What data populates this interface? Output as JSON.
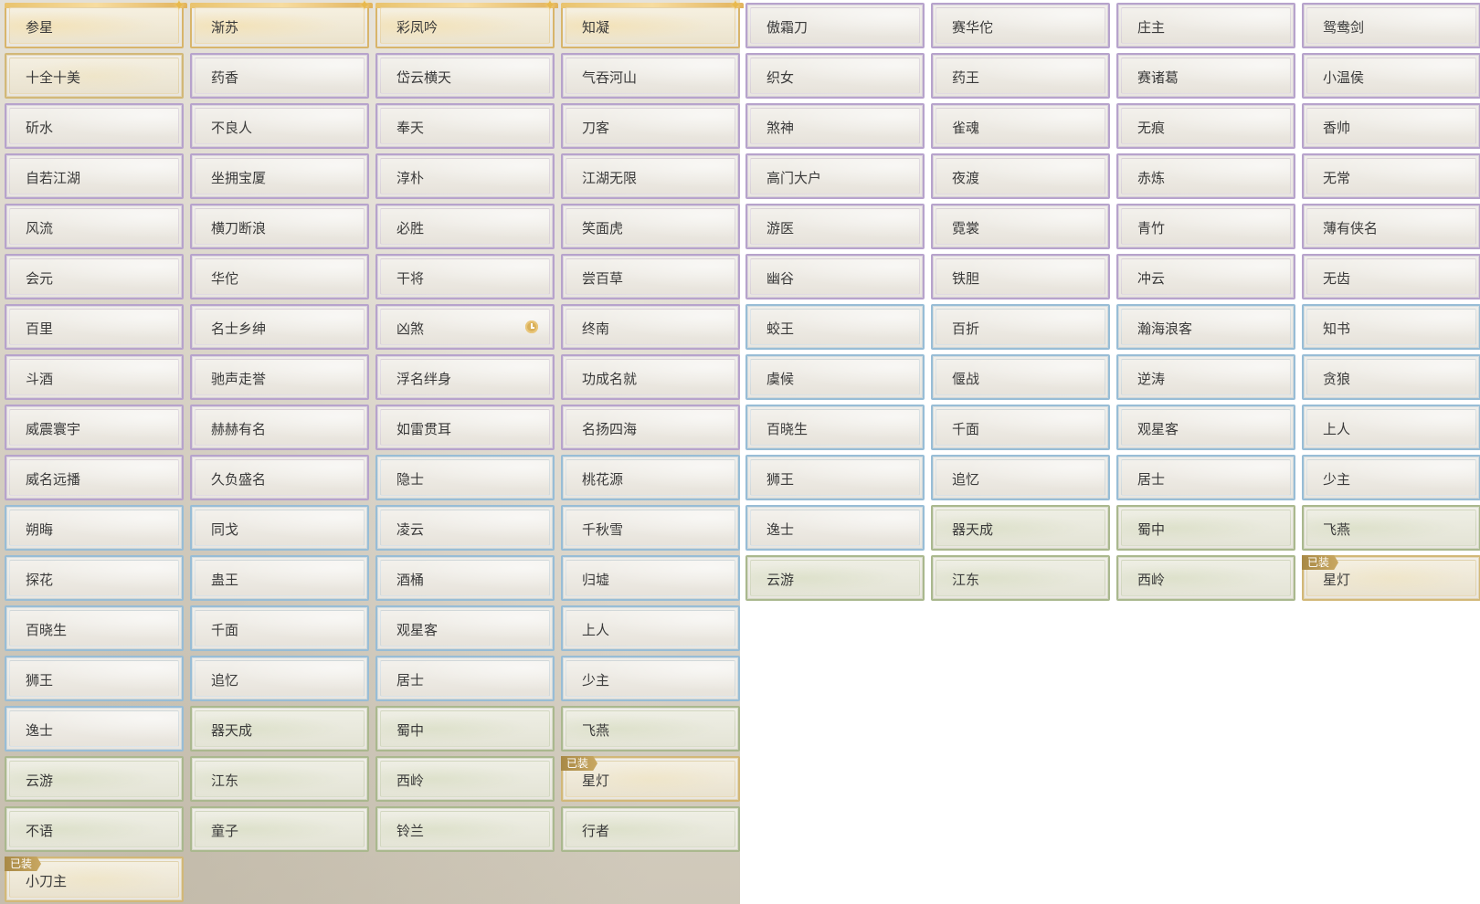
{
  "grid": {
    "rows": [
      [
        {
          "label": "参星",
          "rarity": "legend",
          "sparkle": true
        },
        {
          "label": "渐苏",
          "rarity": "legend",
          "sparkle": true
        },
        {
          "label": "彩凤吟",
          "rarity": "legend",
          "sparkle": true
        },
        {
          "label": "知凝",
          "rarity": "legend",
          "sparkle": true
        },
        {
          "label": "傲霜刀",
          "rarity": "purple"
        },
        {
          "label": "赛华佗",
          "rarity": "purple"
        },
        {
          "label": "庄主",
          "rarity": "purple"
        },
        {
          "label": "鸳鸯剑",
          "rarity": "purple"
        }
      ],
      [
        {
          "label": "十全十美",
          "rarity": "gold"
        },
        {
          "label": "药香",
          "rarity": "purple"
        },
        {
          "label": "岱云横天",
          "rarity": "purple"
        },
        {
          "label": "气吞河山",
          "rarity": "purple"
        },
        {
          "label": "织女",
          "rarity": "purple"
        },
        {
          "label": "药王",
          "rarity": "purple"
        },
        {
          "label": "赛诸葛",
          "rarity": "purple"
        },
        {
          "label": "小温侯",
          "rarity": "purple"
        }
      ],
      [
        {
          "label": "斫水",
          "rarity": "purple"
        },
        {
          "label": "不良人",
          "rarity": "purple"
        },
        {
          "label": "奉天",
          "rarity": "purple"
        },
        {
          "label": "刀客",
          "rarity": "purple"
        },
        {
          "label": "煞神",
          "rarity": "purple"
        },
        {
          "label": "雀魂",
          "rarity": "purple"
        },
        {
          "label": "无痕",
          "rarity": "purple"
        },
        {
          "label": "香帅",
          "rarity": "purple"
        }
      ],
      [
        {
          "label": "自若江湖",
          "rarity": "purple"
        },
        {
          "label": "坐拥宝厦",
          "rarity": "purple"
        },
        {
          "label": "淳朴",
          "rarity": "purple"
        },
        {
          "label": "江湖无限",
          "rarity": "purple"
        },
        {
          "label": "高门大户",
          "rarity": "purple"
        },
        {
          "label": "夜渡",
          "rarity": "purple"
        },
        {
          "label": "赤炼",
          "rarity": "purple"
        },
        {
          "label": "无常",
          "rarity": "purple"
        }
      ],
      [
        {
          "label": "风流",
          "rarity": "purple"
        },
        {
          "label": "横刀断浪",
          "rarity": "purple"
        },
        {
          "label": "必胜",
          "rarity": "purple"
        },
        {
          "label": "笑面虎",
          "rarity": "purple"
        },
        {
          "label": "游医",
          "rarity": "purple"
        },
        {
          "label": "霓裳",
          "rarity": "purple"
        },
        {
          "label": "青竹",
          "rarity": "purple"
        },
        {
          "label": "薄有侠名",
          "rarity": "purple"
        }
      ],
      [
        {
          "label": "会元",
          "rarity": "purple"
        },
        {
          "label": "华佗",
          "rarity": "purple"
        },
        {
          "label": "干将",
          "rarity": "purple"
        },
        {
          "label": "尝百草",
          "rarity": "purple"
        },
        {
          "label": "幽谷",
          "rarity": "purple"
        },
        {
          "label": "铁胆",
          "rarity": "purple"
        },
        {
          "label": "冲云",
          "rarity": "purple"
        },
        {
          "label": "无齿",
          "rarity": "purple"
        }
      ],
      [
        {
          "label": "百里",
          "rarity": "purple"
        },
        {
          "label": "名士乡绅",
          "rarity": "purple"
        },
        {
          "label": "凶煞",
          "rarity": "purple",
          "clock": true
        },
        {
          "label": "终南",
          "rarity": "purple"
        },
        {
          "label": "蛟王",
          "rarity": "blue"
        },
        {
          "label": "百折",
          "rarity": "blue"
        },
        {
          "label": "瀚海浪客",
          "rarity": "blue"
        },
        {
          "label": "知书",
          "rarity": "blue"
        }
      ],
      [
        {
          "label": "斗酒",
          "rarity": "purple"
        },
        {
          "label": "驰声走誉",
          "rarity": "purple"
        },
        {
          "label": "浮名绊身",
          "rarity": "purple"
        },
        {
          "label": "功成名就",
          "rarity": "purple"
        },
        {
          "label": "虞候",
          "rarity": "blue"
        },
        {
          "label": "偃战",
          "rarity": "blue"
        },
        {
          "label": "逆涛",
          "rarity": "blue"
        },
        {
          "label": "贪狼",
          "rarity": "blue"
        }
      ],
      [
        {
          "label": "威震寰宇",
          "rarity": "purple"
        },
        {
          "label": "赫赫有名",
          "rarity": "purple"
        },
        {
          "label": "如雷贯耳",
          "rarity": "purple"
        },
        {
          "label": "名扬四海",
          "rarity": "purple"
        },
        {
          "label": "百晓生",
          "rarity": "blue"
        },
        {
          "label": "千面",
          "rarity": "blue"
        },
        {
          "label": "观星客",
          "rarity": "blue"
        },
        {
          "label": "上人",
          "rarity": "blue"
        }
      ],
      [
        {
          "label": "威名远播",
          "rarity": "purple"
        },
        {
          "label": "久负盛名",
          "rarity": "purple"
        },
        {
          "label": "隐士",
          "rarity": "blue"
        },
        {
          "label": "桃花源",
          "rarity": "blue"
        },
        {
          "label": "狮王",
          "rarity": "blue"
        },
        {
          "label": "追忆",
          "rarity": "blue"
        },
        {
          "label": "居士",
          "rarity": "blue"
        },
        {
          "label": "少主",
          "rarity": "blue"
        }
      ],
      [
        {
          "label": "朔晦",
          "rarity": "blue"
        },
        {
          "label": "同戈",
          "rarity": "blue"
        },
        {
          "label": "凌云",
          "rarity": "blue"
        },
        {
          "label": "千秋雪",
          "rarity": "blue"
        },
        {
          "label": "逸士",
          "rarity": "blue"
        },
        {
          "label": "器天成",
          "rarity": "green"
        },
        {
          "label": "蜀中",
          "rarity": "green"
        },
        {
          "label": "飞燕",
          "rarity": "green"
        }
      ],
      [
        {
          "label": "探花",
          "rarity": "blue"
        },
        {
          "label": "蛊王",
          "rarity": "blue"
        },
        {
          "label": "酒桶",
          "rarity": "blue"
        },
        {
          "label": "归墟",
          "rarity": "blue"
        },
        {
          "label": "云游",
          "rarity": "green"
        },
        {
          "label": "江东",
          "rarity": "green"
        },
        {
          "label": "西岭",
          "rarity": "green"
        },
        {
          "label": "星灯",
          "rarity": "gold",
          "badge": "已装"
        }
      ],
      [
        {
          "label": "百晓生",
          "rarity": "blue"
        },
        {
          "label": "千面",
          "rarity": "blue"
        },
        {
          "label": "观星客",
          "rarity": "blue"
        },
        {
          "label": "上人",
          "rarity": "blue"
        }
      ],
      [
        {
          "label": "狮王",
          "rarity": "blue"
        },
        {
          "label": "追忆",
          "rarity": "blue"
        },
        {
          "label": "居士",
          "rarity": "blue"
        },
        {
          "label": "少主",
          "rarity": "blue"
        }
      ],
      [
        {
          "label": "逸士",
          "rarity": "blue"
        },
        {
          "label": "器天成",
          "rarity": "green"
        },
        {
          "label": "蜀中",
          "rarity": "green"
        },
        {
          "label": "飞燕",
          "rarity": "green"
        }
      ],
      [
        {
          "label": "云游",
          "rarity": "green"
        },
        {
          "label": "江东",
          "rarity": "green"
        },
        {
          "label": "西岭",
          "rarity": "green"
        },
        {
          "label": "星灯",
          "rarity": "gold",
          "badge": "已装"
        }
      ],
      [
        {
          "label": "不语",
          "rarity": "green"
        },
        {
          "label": "童子",
          "rarity": "green"
        },
        {
          "label": "铃兰",
          "rarity": "green"
        },
        {
          "label": "行者",
          "rarity": "green"
        }
      ],
      [
        {
          "label": "小刀主",
          "rarity": "gold",
          "badge": "已装"
        }
      ]
    ]
  },
  "icons": {
    "sparkle": "sparkle-icon",
    "clock": "clock-icon"
  },
  "colors": {
    "purple_border": "#b7a3cc",
    "blue_border": "#98bdd6",
    "green_border": "#aab88e",
    "gold_border": "#d2b878",
    "badge_bg": "#a88946",
    "text": "#3a3a3a"
  }
}
